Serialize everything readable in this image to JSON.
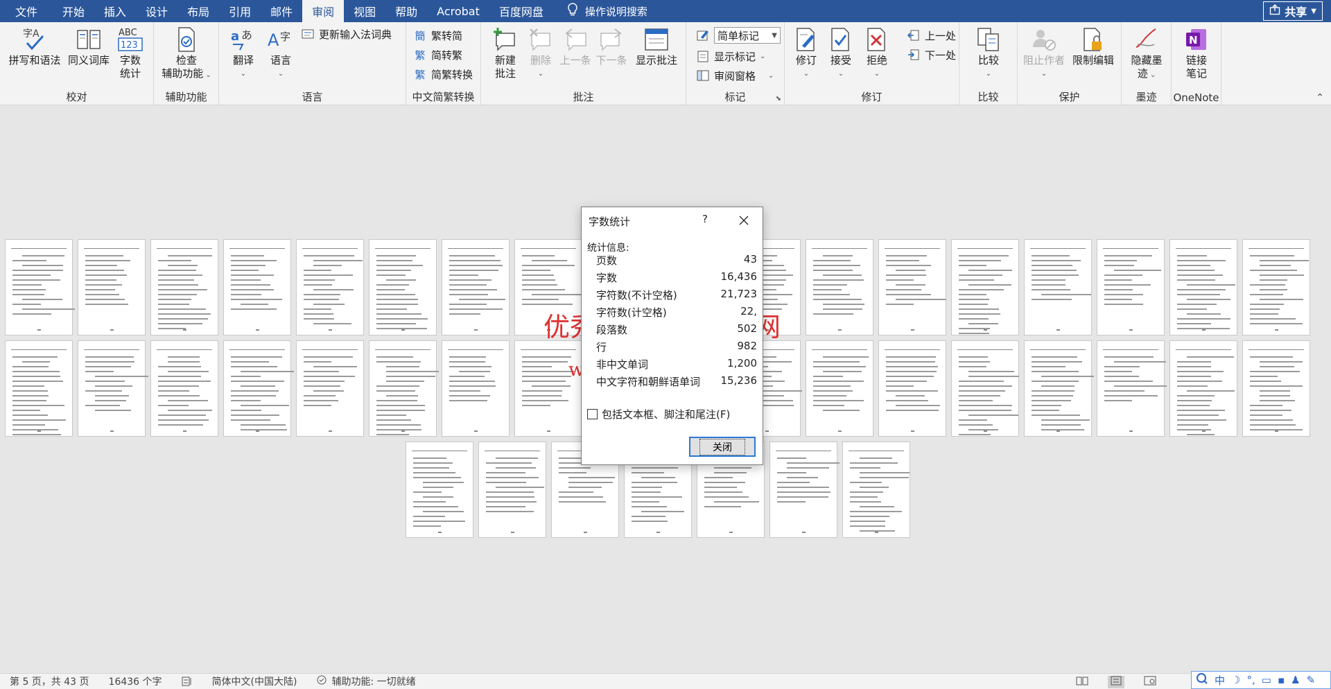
{
  "tabs": [
    "文件",
    "开始",
    "插入",
    "设计",
    "布局",
    "引用",
    "邮件",
    "审阅",
    "视图",
    "帮助",
    "Acrobat",
    "百度网盘"
  ],
  "active_tab": "审阅",
  "tell_me": "操作说明搜索",
  "share": "共享",
  "ribbon": {
    "proofing": {
      "label": "校对",
      "spelling": "拼写和语法",
      "thesaurus": "同义词库",
      "wordcount_l1": "字数",
      "wordcount_l2": "统计"
    },
    "accessibility": {
      "label": "辅助功能",
      "check_l1": "检查",
      "check_l2": "辅助功能"
    },
    "language": {
      "label": "语言",
      "translate": "翻译",
      "language": "语言",
      "ime_dict": "更新输入法词典"
    },
    "chinese": {
      "label": "中文简繁转换",
      "to_simplified": "繁转简",
      "to_traditional": "简转繁",
      "convert": "简繁转换"
    },
    "comments": {
      "label": "批注",
      "new_l1": "新建",
      "new_l2": "批注",
      "delete": "删除",
      "prev": "上一条",
      "next": "下一条",
      "show": "显示批注"
    },
    "tracking": {
      "label": "标记",
      "markup_value": "简单标记",
      "show_markup": "显示标记",
      "reviewing_pane": "审阅窗格"
    },
    "changes": {
      "label": "修订",
      "track": "修订",
      "accept": "接受",
      "reject": "拒绝",
      "previous": "上一处",
      "next": "下一处"
    },
    "compare": {
      "label": "比较",
      "compare": "比较"
    },
    "protect": {
      "label": "保护",
      "block_authors": "阻止作者",
      "restrict": "限制编辑"
    },
    "ink": {
      "label": "墨迹",
      "hide_l1": "隐藏墨",
      "hide_l2": "迹"
    },
    "onenote": {
      "label": "OneNote",
      "link_l1": "链接",
      "link_l2": "笔记"
    }
  },
  "dialog": {
    "title": "字数统计",
    "help": "?",
    "section": "统计信息:",
    "stats": [
      {
        "label": "页数",
        "value": "43"
      },
      {
        "label": "字数",
        "value": "16,436"
      },
      {
        "label": "字符数(不计空格)",
        "value": "21,723"
      },
      {
        "label": "字符数(计空格)",
        "value": "22,"
      },
      {
        "label": "段落数",
        "value": "502"
      },
      {
        "label": "行",
        "value": "982"
      },
      {
        "label": "非中文单词",
        "value": "1,200"
      },
      {
        "label": "中文字符和朝鲜语单词",
        "value": "15,236"
      }
    ],
    "checkbox": "包括文本框、脚注和尾注(F)",
    "close": "关闭"
  },
  "watermark": {
    "line1": "优秀毕业设计资源网",
    "line2": "www.heyicad.net"
  },
  "status": {
    "page": "第 5 页，共 43 页",
    "words": "16436 个字",
    "language": "简体中文(中国大陆)",
    "accessibility": "辅助功能: 一切就绪"
  },
  "ime": {
    "mode": "中"
  }
}
